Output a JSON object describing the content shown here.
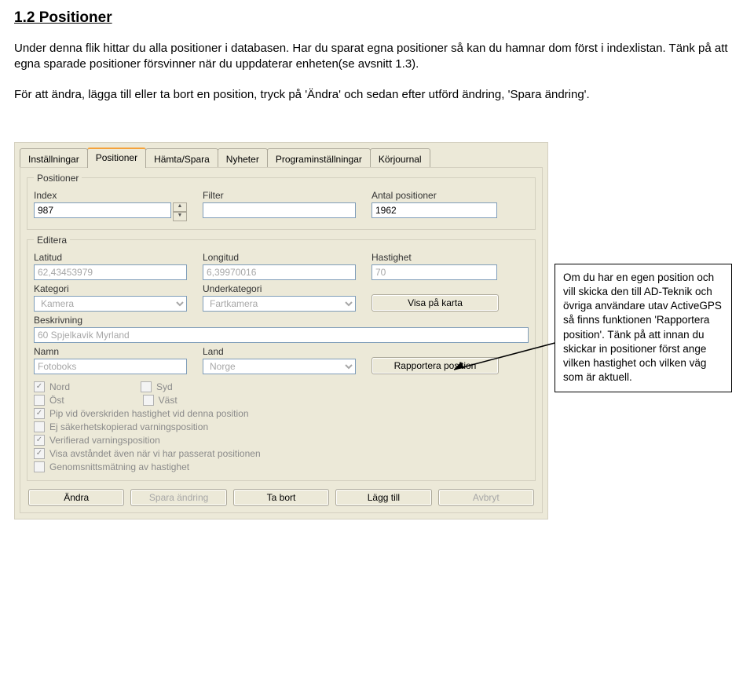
{
  "heading": "1.2 Positioner",
  "paragraph1": "Under denna flik hittar du alla positioner i databasen. Har du sparat egna positioner så kan du hamnar dom först i indexlistan. Tänk på att egna sparade positioner försvinner när du uppdaterar enheten(se avsnitt 1.3).",
  "paragraph2": "För att ändra, lägga till eller ta bort en position, tryck på 'Ändra' och sedan efter utförd ändring, 'Spara ändring'.",
  "tabs": {
    "installningar": "Inställningar",
    "positioner": "Positioner",
    "hamta": "Hämta/Spara",
    "nyheter": "Nyheter",
    "program": "Programinställningar",
    "korjournal": "Körjournal"
  },
  "positioner_group": {
    "legend": "Positioner",
    "index_label": "Index",
    "index_value": "987",
    "filter_label": "Filter",
    "filter_value": "",
    "antal_label": "Antal positioner",
    "antal_value": "1962"
  },
  "editera_group": {
    "legend": "Editera",
    "lat_label": "Latitud",
    "lat_value": "62,43453979",
    "lon_label": "Longitud",
    "lon_value": "6,39970016",
    "hast_label": "Hastighet",
    "hast_value": "70",
    "kategori_label": "Kategori",
    "kategori_value": "Kamera",
    "underkategori_label": "Underkategori",
    "underkategori_value": "Fartkamera",
    "visa_btn": "Visa på karta",
    "beskrivning_label": "Beskrivning",
    "beskrivning_value": "60 Spjelkavik Myrland",
    "namn_label": "Namn",
    "namn_value": "Fotoboks",
    "land_label": "Land",
    "land_value": "Norge",
    "rapportera_btn": "Rapportera position",
    "checks": {
      "nord": "Nord",
      "syd": "Syd",
      "ost": "Öst",
      "vast": "Väst",
      "pip": "Pip vid överskriden hastighet vid denna position",
      "ej": "Ej säkerhetskopierad varningsposition",
      "verifierad": "Verifierad varningsposition",
      "visa_avst": "Visa avståndet även när vi har passerat positionen",
      "genomsnitt": "Genomsnittsmätning av hastighet"
    }
  },
  "bottom_buttons": {
    "andra": "Ändra",
    "spara": "Spara ändring",
    "tabort": "Ta bort",
    "lagg": "Lägg till",
    "avbryt": "Avbryt"
  },
  "callout": "Om du har en egen position och vill skicka den till AD-Teknik och övriga användare utav ActiveGPS så finns funktionen 'Rapportera position'. Tänk på att innan du skickar in positioner först ange vilken hastighet och vilken väg som är aktuell."
}
